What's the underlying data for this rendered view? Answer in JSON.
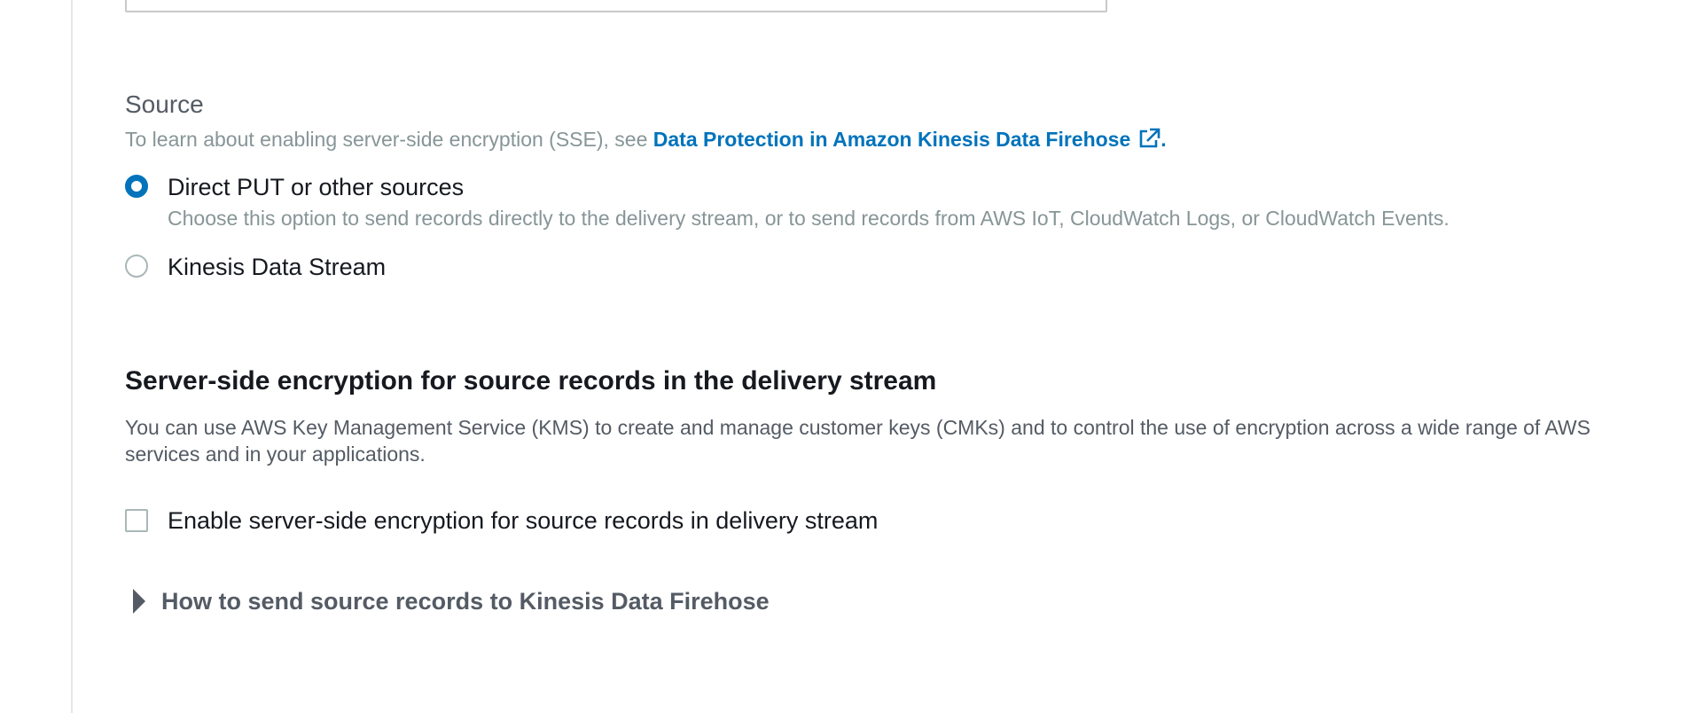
{
  "source": {
    "label": "Source",
    "description_prefix": "To learn about enabling server-side encryption (SSE), see ",
    "link_text": "Data Protection in Amazon Kinesis Data Firehose",
    "description_suffix": ".",
    "link_icon": "external-link-icon",
    "accent_color": "#0073bb",
    "options": [
      {
        "label": "Direct PUT or other sources",
        "description": "Choose this option to send records directly to the delivery stream, or to send records from AWS IoT, CloudWatch Logs, or CloudWatch Events.",
        "selected": true
      },
      {
        "label": "Kinesis Data Stream",
        "selected": false
      }
    ]
  },
  "sse": {
    "heading": "Server-side encryption for source records in the delivery stream",
    "description": "You can use AWS Key Management Service (KMS) to create and manage customer keys (CMKs) and to control the use of encryption across a wide range of AWS services and in your applications.",
    "checkbox_label": "Enable server-side encryption for source records in delivery stream",
    "checked": false
  },
  "expander": {
    "label": "How to send source records to Kinesis Data Firehose",
    "icon": "caret-right-icon",
    "expanded": false
  }
}
